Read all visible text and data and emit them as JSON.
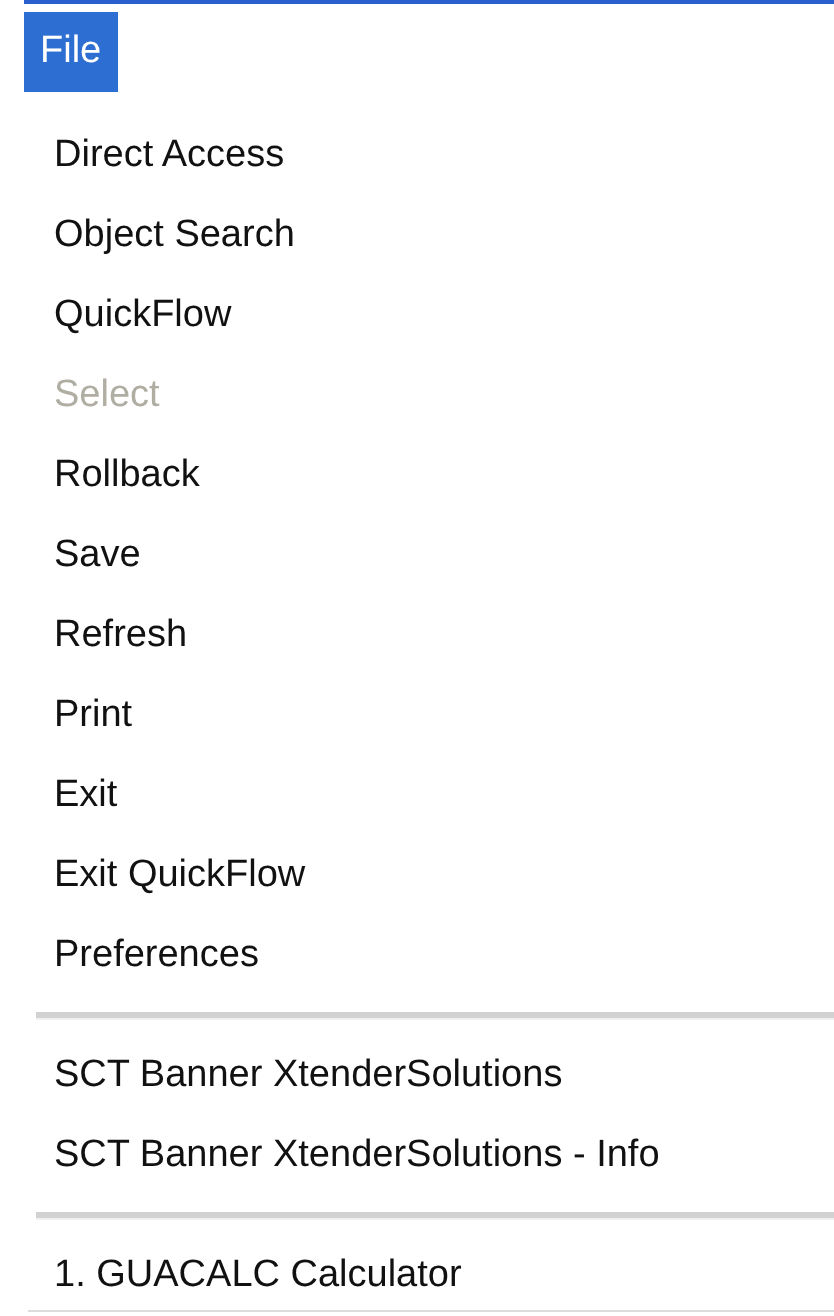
{
  "menu_bar": {
    "title": "File",
    "selected": true
  },
  "menu": [
    {
      "kind": "item",
      "label": "Direct Access",
      "disabled": false
    },
    {
      "kind": "item",
      "label": "Object Search",
      "disabled": false
    },
    {
      "kind": "item",
      "label": "QuickFlow",
      "disabled": false
    },
    {
      "kind": "item",
      "label": "Select",
      "disabled": true
    },
    {
      "kind": "item",
      "label": "Rollback",
      "disabled": false
    },
    {
      "kind": "item",
      "label": "Save",
      "disabled": false
    },
    {
      "kind": "item",
      "label": "Refresh",
      "disabled": false
    },
    {
      "kind": "item",
      "label": "Print",
      "disabled": false
    },
    {
      "kind": "item",
      "label": "Exit",
      "disabled": false
    },
    {
      "kind": "item",
      "label": "Exit QuickFlow",
      "disabled": false
    },
    {
      "kind": "item",
      "label": "Preferences",
      "disabled": false
    },
    {
      "kind": "separator"
    },
    {
      "kind": "item",
      "label": "SCT Banner XtenderSolutions",
      "disabled": false
    },
    {
      "kind": "item",
      "label": "SCT Banner XtenderSolutions - Info",
      "disabled": false
    },
    {
      "kind": "separator"
    },
    {
      "kind": "item",
      "label": "1. GUACALC Calculator",
      "disabled": false
    }
  ]
}
